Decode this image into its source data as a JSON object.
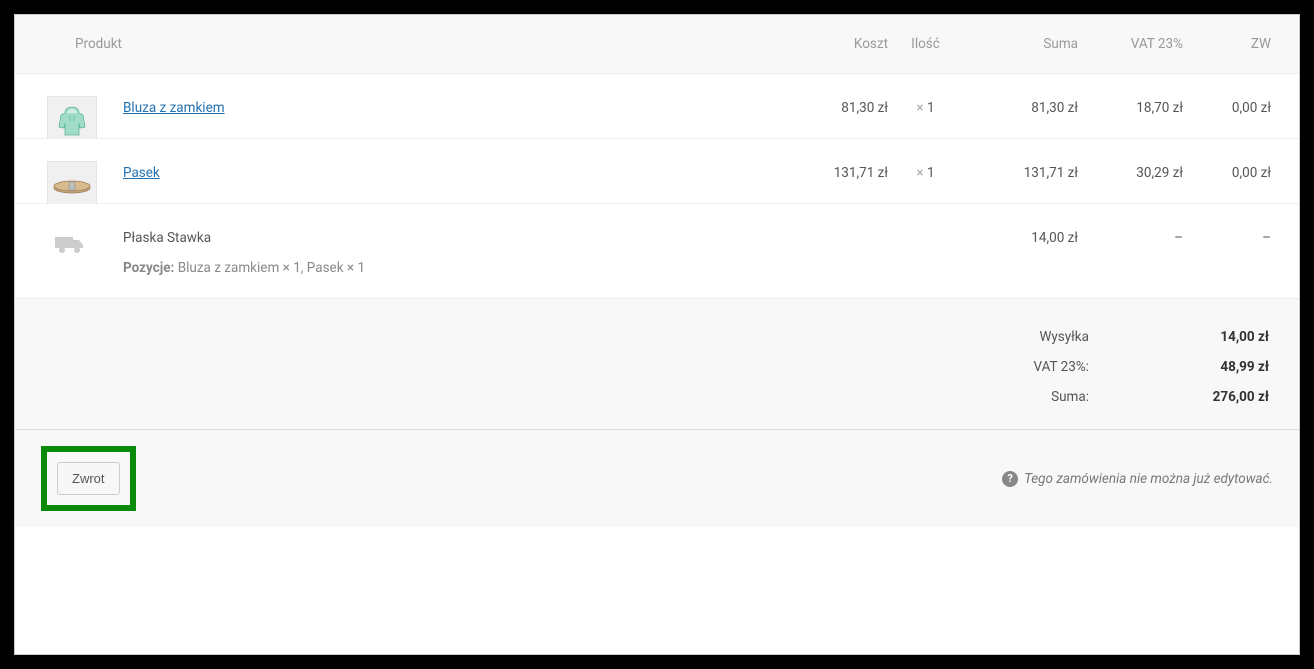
{
  "headers": {
    "product": "Produkt",
    "cost": "Koszt",
    "qty": "Ilość",
    "sum": "Suma",
    "vat": "VAT 23%",
    "zw": "ZW"
  },
  "items": [
    {
      "name": "Bluza z zamkiem",
      "cost": "81,30 zł",
      "qty_x": "×",
      "qty": "1",
      "sum": "81,30 zł",
      "vat": "18,70 zł",
      "zw": "0,00 zł"
    },
    {
      "name": "Pasek",
      "cost": "131,71 zł",
      "qty_x": "×",
      "qty": "1",
      "sum": "131,71 zł",
      "vat": "30,29 zł",
      "zw": "0,00 zł"
    }
  ],
  "shipping": {
    "title": "Płaska Stawka",
    "items_label": "Pozycje:",
    "items_text": "Bluza z zamkiem × 1, Pasek × 1",
    "sum": "14,00 zł",
    "vat": "–",
    "zw": "–"
  },
  "totals": {
    "shipping_label": "Wysyłka",
    "shipping_value": "14,00 zł",
    "vat_label": "VAT 23%:",
    "vat_value": "48,99 zł",
    "sum_label": "Suma:",
    "sum_value": "276,00 zł"
  },
  "footer": {
    "refund_button": "Zwrot",
    "note": "Tego zamówienia nie można już edytować."
  }
}
